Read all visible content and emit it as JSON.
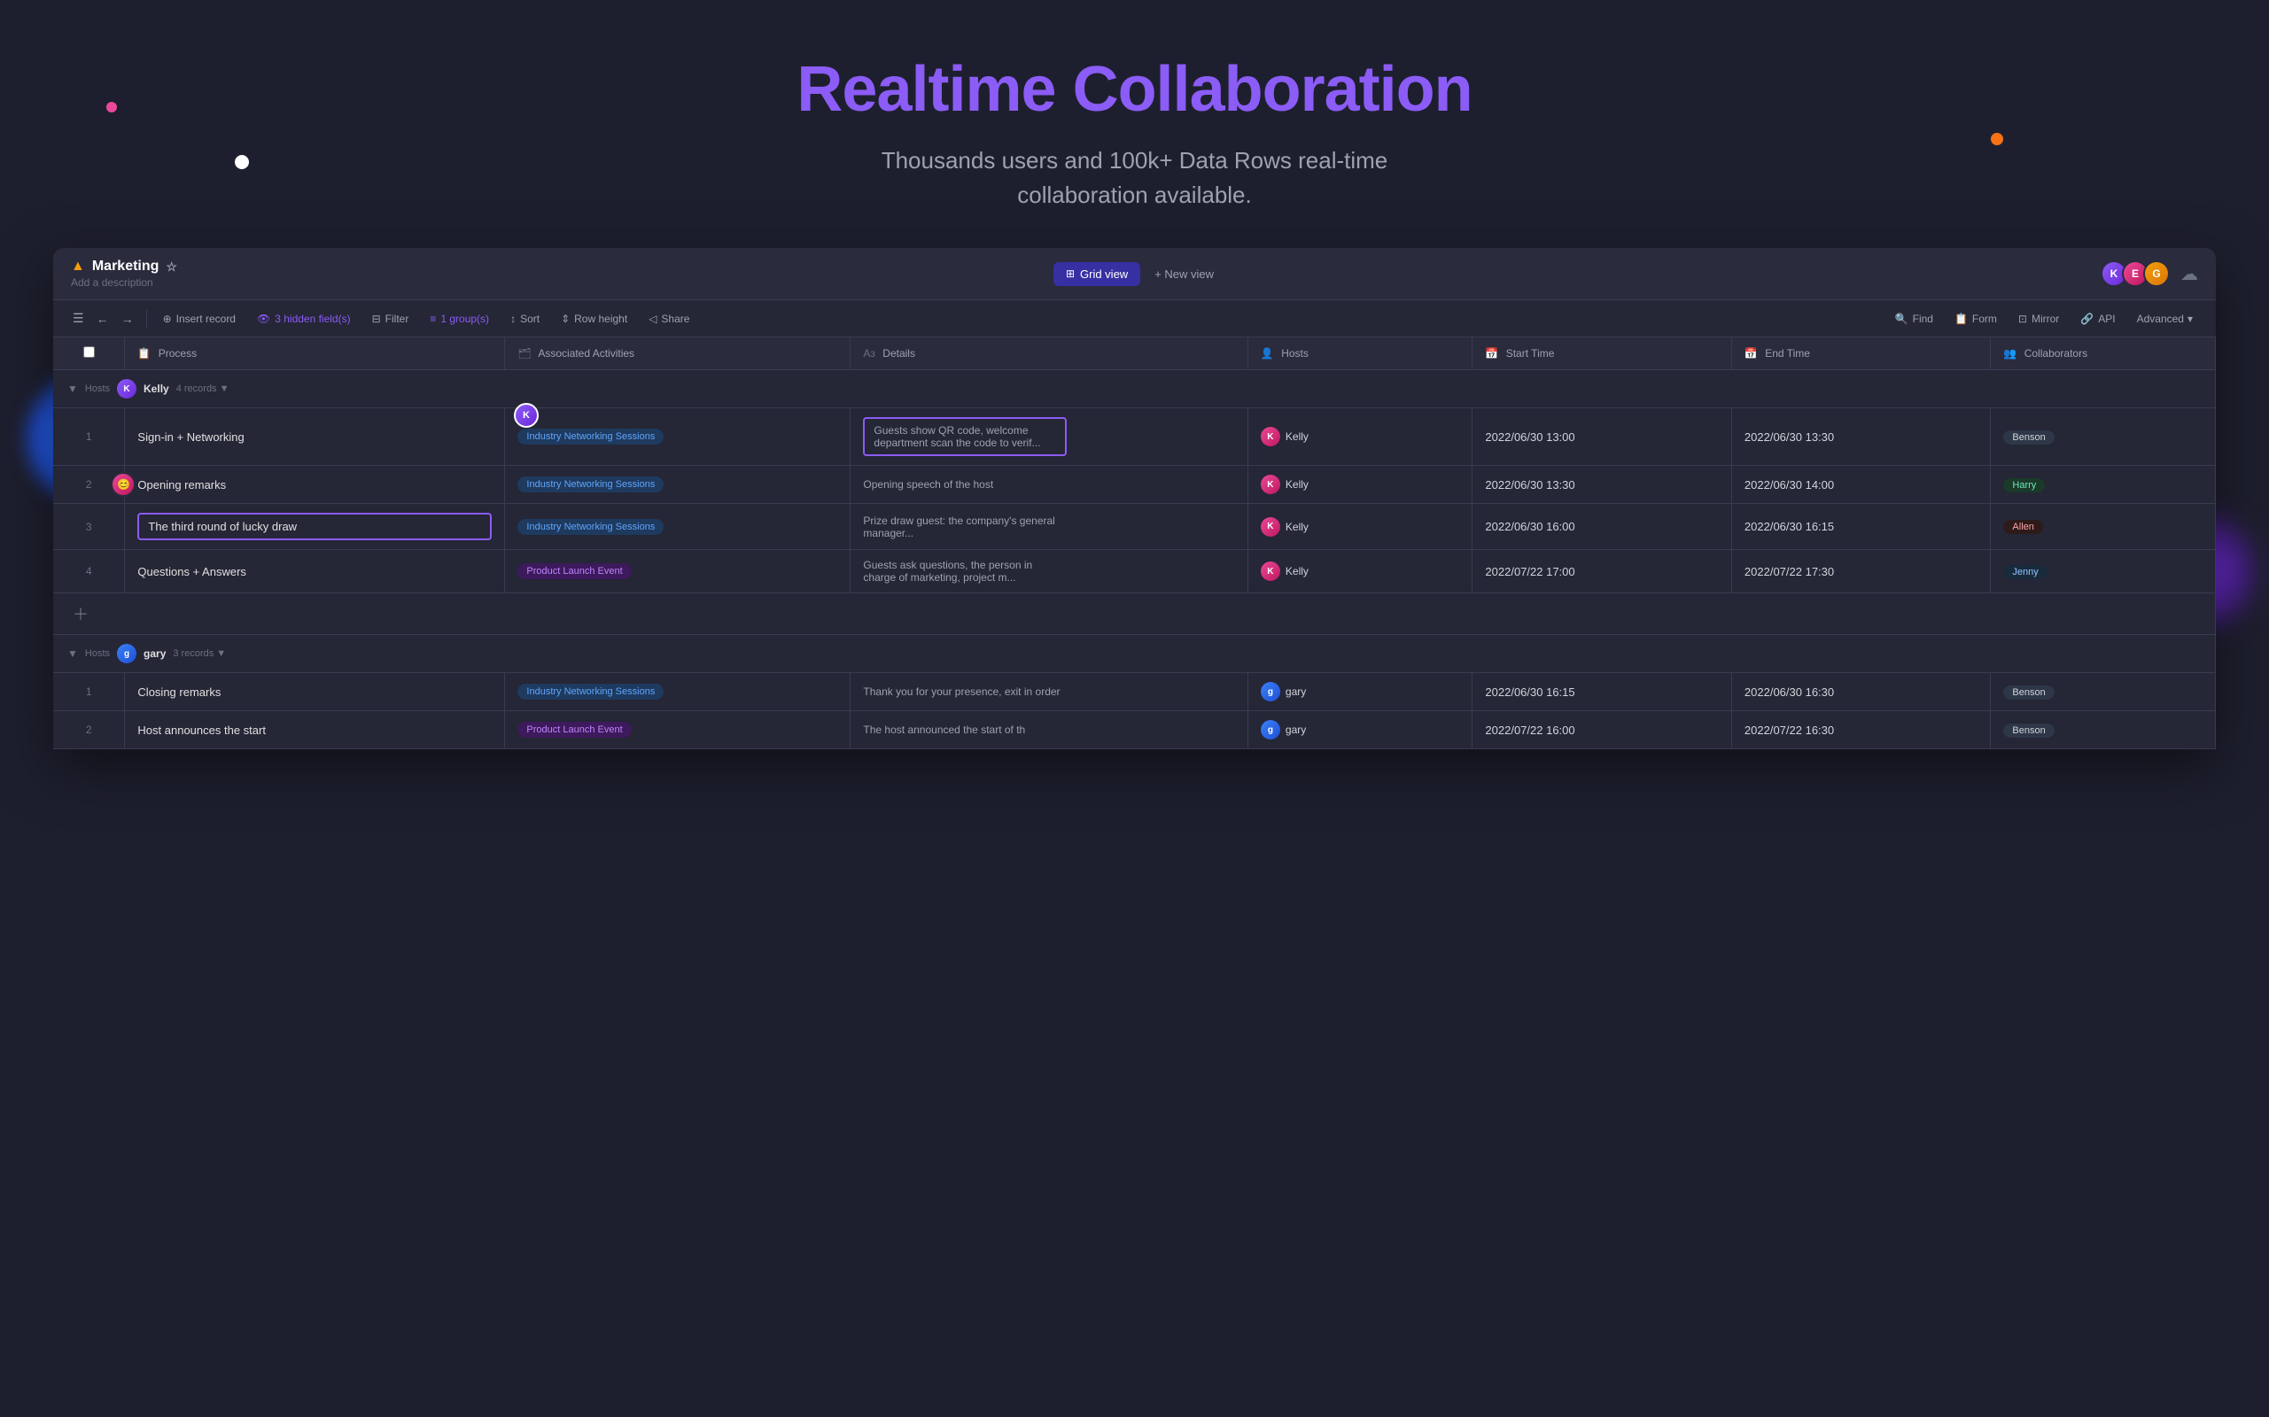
{
  "hero": {
    "title_white": "Realtime",
    "title_purple": "Collaboration",
    "subtitle": "Thousands users and 100k+ Data Rows real-time collaboration available."
  },
  "app": {
    "title": "Marketing",
    "add_description": "Add a description",
    "view_tabs": [
      {
        "label": "Grid view",
        "icon": "⊞",
        "active": true
      },
      {
        "label": "+ New view",
        "icon": "",
        "active": false
      }
    ]
  },
  "toolbar": {
    "insert_record": "Insert record",
    "hidden_fields": "3 hidden field(s)",
    "filter": "Filter",
    "group": "1 group(s)",
    "sort": "Sort",
    "row_height": "Row height",
    "share": "Share",
    "find": "Find",
    "form": "Form",
    "mirror": "Mirror",
    "api": "API",
    "advanced": "Advanced"
  },
  "columns": [
    {
      "label": "Process",
      "icon": "📋"
    },
    {
      "label": "Associated Activities",
      "icon": "🗂"
    },
    {
      "label": "Details",
      "icon": "Aз"
    },
    {
      "label": "Hosts",
      "icon": "👤"
    },
    {
      "label": "Start Time",
      "icon": "📅"
    },
    {
      "label": "End Time",
      "icon": "📅"
    },
    {
      "label": "Collaborators",
      "icon": "👥"
    }
  ],
  "group1": {
    "label": "Kelly",
    "count": "4 records",
    "avatar": "K",
    "rows": [
      {
        "num": "1",
        "process": "Sign-in + Networking",
        "activity": "Industry Networking Sessions",
        "activity_type": "networking",
        "details": "Guests show QR code, welcome department scan the code to verif...",
        "details_highlighted": true,
        "host_name": "Kelly",
        "host_type": "kelly",
        "start": "2022/06/30 13:00",
        "end": "2022/06/30 13:30",
        "collaborator": "Benson",
        "collab_type": "benson"
      },
      {
        "num": "2",
        "process": "Opening remarks",
        "activity": "Industry Networking Sessions",
        "activity_type": "networking",
        "details": "Opening speech of the host",
        "details_highlighted": false,
        "host_name": "Kelly",
        "host_type": "kelly",
        "start": "2022/06/30 13:30",
        "end": "2022/06/30 14:00",
        "collaborator": "Harry",
        "collab_type": "harry"
      },
      {
        "num": "3",
        "process": "The third round of lucky draw",
        "process_selected": true,
        "activity": "Industry Networking Sessions",
        "activity_type": "networking",
        "details": "Prize draw guest: the company's general manager...",
        "details_highlighted": false,
        "host_name": "Kelly",
        "host_type": "kelly",
        "start": "2022/06/30 16:00",
        "end": "2022/06/30 16:15",
        "collaborator": "Allen",
        "collab_type": "allen"
      },
      {
        "num": "4",
        "process": "Questions + Answers",
        "activity": "Product Launch Event",
        "activity_type": "product",
        "details": "Guests ask questions, the person in charge of marketing, project m...",
        "details_highlighted": false,
        "host_name": "Kelly",
        "host_type": "kelly",
        "start": "2022/07/22 17:00",
        "end": "2022/07/22 17:30",
        "collaborator": "Jenny",
        "collab_type": "jenny"
      }
    ]
  },
  "group2": {
    "label": "gary",
    "count": "3 records",
    "avatar": "g",
    "rows": [
      {
        "num": "1",
        "process": "Closing remarks",
        "activity": "Industry Networking Sessions",
        "activity_type": "networking",
        "details": "Thank you for your presence, exit in order",
        "host_name": "gary",
        "host_type": "gary",
        "start": "2022/06/30 16:15",
        "end": "2022/06/30 16:30",
        "collaborator": "Benson",
        "collab_type": "benson"
      },
      {
        "num": "2",
        "process": "Host announces the start",
        "activity": "Product Launch Event",
        "activity_type": "product",
        "details": "The host announced the start of th",
        "host_name": "gary",
        "host_type": "gary",
        "start": "2022/07/22 16:00",
        "end": "2022/07/22 16:30",
        "collaborator": "Benson",
        "collab_type": "benson"
      }
    ]
  }
}
